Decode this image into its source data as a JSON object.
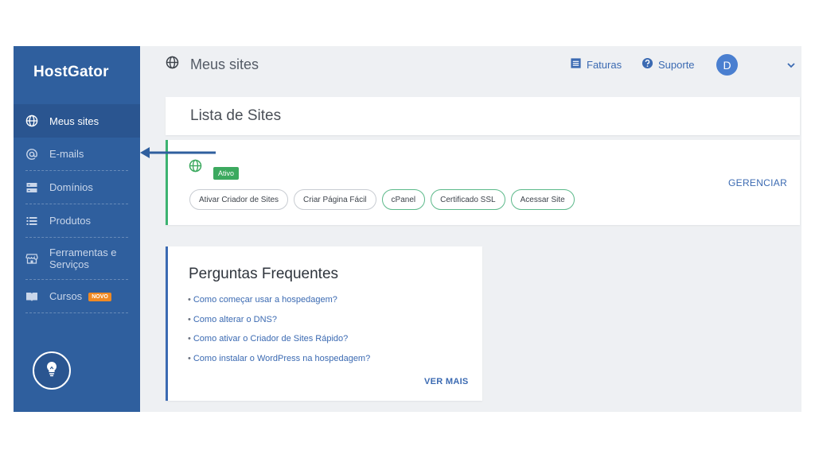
{
  "app": {
    "logo": "HostGator"
  },
  "sidebar": {
    "items": [
      {
        "label": "Meus sites",
        "icon": "globe-icon",
        "active": true
      },
      {
        "label": "E-mails",
        "icon": "at-icon"
      },
      {
        "label": "Domínios",
        "icon": "server-icon"
      },
      {
        "label": "Produtos",
        "icon": "list-icon"
      },
      {
        "label": "Ferramentas e Serviços",
        "icon": "store-icon"
      },
      {
        "label": "Cursos",
        "icon": "book-icon",
        "badge": "NOVO"
      }
    ],
    "help_icon": "lightbulb-icon"
  },
  "header": {
    "title": "Meus sites",
    "invoices_label": "Faturas",
    "support_label": "Suporte",
    "avatar_initial": "D"
  },
  "sites": {
    "title": "Lista de Sites",
    "status": "Ativo",
    "actions": [
      "Ativar Criador de Sites",
      "Criar Página Fácil",
      "cPanel",
      "Certificado SSL",
      "Acessar Site"
    ],
    "manage_label": "GERENCIAR"
  },
  "faq": {
    "title": "Perguntas Frequentes",
    "items": [
      "Como começar usar a hospedagem?",
      "Como alterar o DNS?",
      "Como ativar o Criador de Sites Rápido?",
      "Como instalar o WordPress na hospedagem?"
    ],
    "see_more_label": "VER MAIS"
  },
  "colors": {
    "sidebar": "#2f5f9e",
    "accent": "#3b6ab2",
    "active_green": "#3ca95f",
    "badge_orange": "#f08a24"
  }
}
